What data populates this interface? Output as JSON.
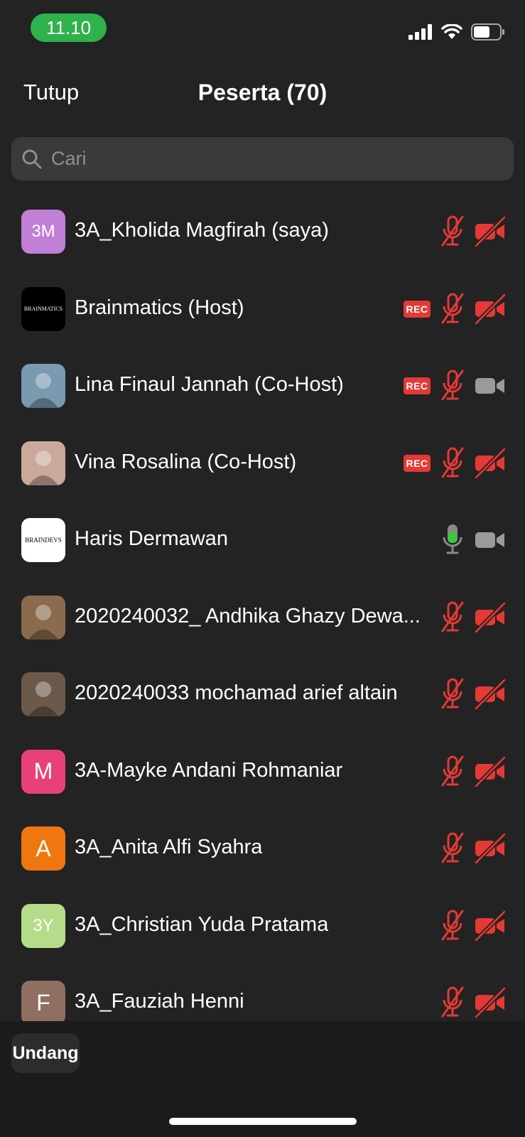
{
  "status": {
    "time": "11.10"
  },
  "header": {
    "close_label": "Tutup",
    "title": "Peserta (70)"
  },
  "search": {
    "placeholder": "Cari"
  },
  "participants": [
    {
      "name": "3A_Kholida Magfirah (saya)",
      "avatar": "3M",
      "avatar_color": "#c17fd6",
      "rec": false,
      "mic": "muted",
      "cam": "off"
    },
    {
      "name": "Brainmatics (Host)",
      "avatar": "BRAINMATICS",
      "avatar_color": "#000000",
      "rec": true,
      "rec_label": "REC",
      "mic": "muted",
      "cam": "off"
    },
    {
      "name": "Lina Finaul Jannah (Co-Host)",
      "avatar": "photo",
      "avatar_color": "#7a9ab0",
      "rec": true,
      "rec_label": "REC",
      "mic": "muted",
      "cam": "on"
    },
    {
      "name": "Vina Rosalina (Co-Host)",
      "avatar": "photo",
      "avatar_color": "#c9a99a",
      "rec": true,
      "rec_label": "REC",
      "mic": "muted",
      "cam": "off"
    },
    {
      "name": "Haris Dermawan",
      "avatar": "BRAINDEVS",
      "avatar_color": "#ffffff",
      "rec": false,
      "mic": "active",
      "cam": "on"
    },
    {
      "name": "2020240032_ Andhika Ghazy Dewa...",
      "avatar": "photo",
      "avatar_color": "#8a6b4e",
      "rec": false,
      "mic": "muted",
      "cam": "off"
    },
    {
      "name": "2020240033 mochamad arief altain",
      "avatar": "photo",
      "avatar_color": "#6b5a4a",
      "rec": false,
      "mic": "muted",
      "cam": "off"
    },
    {
      "name": "3A-Mayke Andani Rohmaniar",
      "avatar": "M",
      "avatar_color": "#e8417a",
      "rec": false,
      "mic": "muted",
      "cam": "off"
    },
    {
      "name": "3A_Anita Alfi Syahra",
      "avatar": "A",
      "avatar_color": "#f0760f",
      "rec": false,
      "mic": "muted",
      "cam": "off"
    },
    {
      "name": "3A_Christian Yuda Pratama",
      "avatar": "3Y",
      "avatar_color": "#b5dc88",
      "rec": false,
      "mic": "muted",
      "cam": "off"
    },
    {
      "name": "3A_Fauziah Henni",
      "avatar": "F",
      "avatar_color": "#8e6f62",
      "rec": false,
      "mic": "muted",
      "cam": "off"
    }
  ],
  "footer": {
    "invite_label": "Undang"
  },
  "colors": {
    "muted_red": "#e53935",
    "active_green": "#3cc83c",
    "cam_gray": "#9a9a9a"
  }
}
